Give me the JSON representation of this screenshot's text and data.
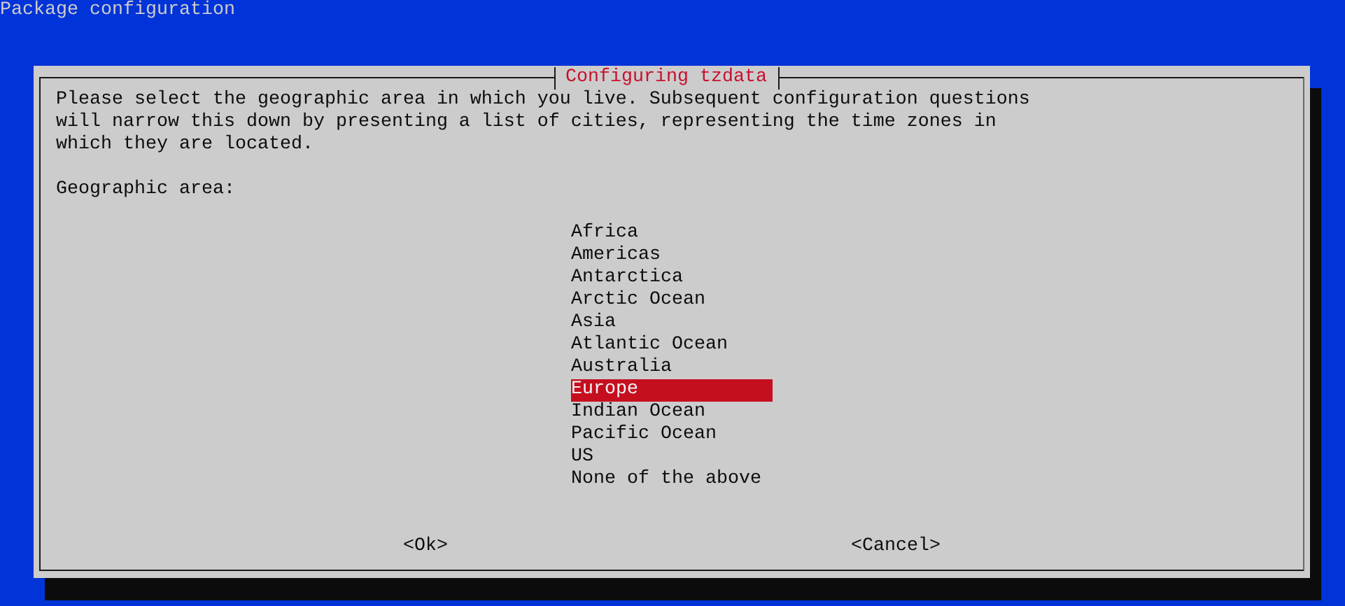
{
  "screen_title": "Package configuration",
  "dialog": {
    "title": "Configuring tzdata",
    "message": "Please select the geographic area in which you live. Subsequent configuration questions will narrow this down by presenting a list of cities, representing the time zones in which they are located.",
    "prompt": "Geographic area:",
    "options": [
      {
        "label": "Africa",
        "selected": false
      },
      {
        "label": "Americas",
        "selected": false
      },
      {
        "label": "Antarctica",
        "selected": false
      },
      {
        "label": "Arctic Ocean",
        "selected": false
      },
      {
        "label": "Asia",
        "selected": false
      },
      {
        "label": "Atlantic Ocean",
        "selected": false
      },
      {
        "label": "Australia",
        "selected": false
      },
      {
        "label": "Europe",
        "selected": true
      },
      {
        "label": "Indian Ocean",
        "selected": false
      },
      {
        "label": "Pacific Ocean",
        "selected": false
      },
      {
        "label": "US",
        "selected": false
      },
      {
        "label": "None of the above",
        "selected": false
      }
    ],
    "buttons": [
      "<Ok>",
      "<Cancel>"
    ]
  }
}
